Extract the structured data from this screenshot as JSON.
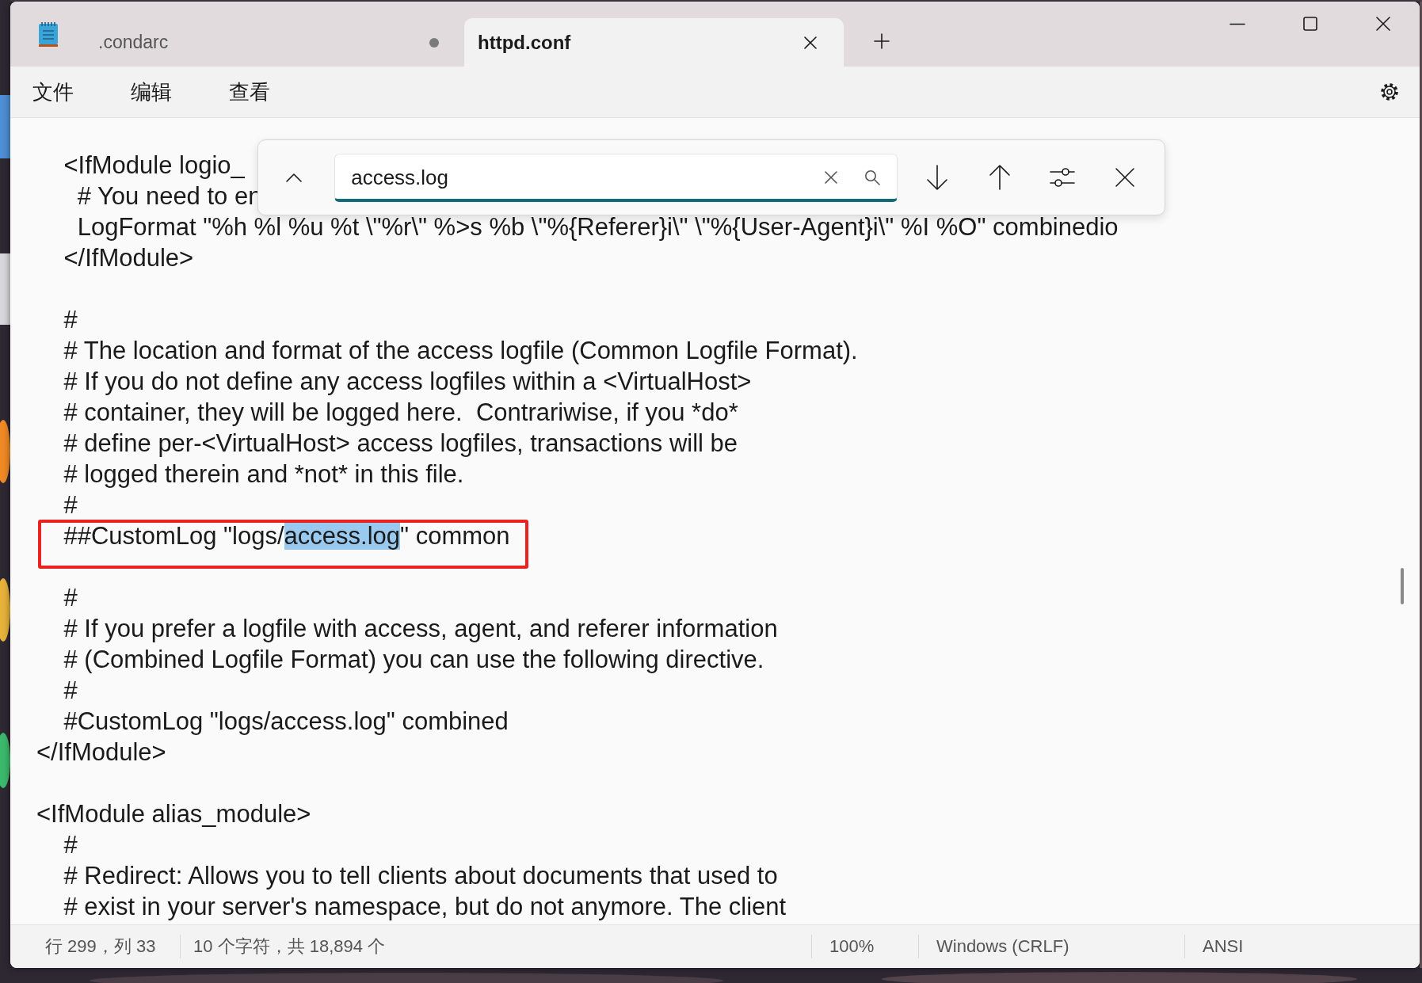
{
  "tabs": [
    {
      "label": ".condarc",
      "selected": false,
      "modified": true
    },
    {
      "label": "httpd.conf",
      "selected": true,
      "modified": false
    }
  ],
  "menu": [
    "文件",
    "编辑",
    "查看"
  ],
  "find_bar": {
    "query": "access.log"
  },
  "editor": {
    "lines": [
      {
        "kind": "plain",
        "text": "    <IfModule logio_"
      },
      {
        "kind": "plain",
        "text": "      # You need to en"
      },
      {
        "kind": "plain",
        "text": "      LogFormat \"%h %l %u %t \\\"%r\\\" %>s %b \\\"%{Referer}i\\\" \\\"%{User-Agent}i\\\" %I %O\" combinedio"
      },
      {
        "kind": "plain",
        "text": "    </IfModule>"
      },
      {
        "kind": "blank"
      },
      {
        "kind": "plain",
        "text": "    #"
      },
      {
        "kind": "plain",
        "text": "    # The location and format of the access logfile (Common Logfile Format)."
      },
      {
        "kind": "plain",
        "text": "    # If you do not define any access logfiles within a <VirtualHost>"
      },
      {
        "kind": "plain",
        "text": "    # container, they will be logged here.  Contrariwise, if you *do*"
      },
      {
        "kind": "plain",
        "text": "    # define per-<VirtualHost> access logfiles, transactions will be"
      },
      {
        "kind": "plain",
        "text": "    # logged therein and *not* in this file."
      },
      {
        "kind": "plain",
        "text": "    #"
      },
      {
        "kind": "match",
        "before": "    ##CustomLog \"logs/",
        "match": "access.log",
        "after": "\" common",
        "boxed": true
      },
      {
        "kind": "blank"
      },
      {
        "kind": "plain",
        "text": "    #"
      },
      {
        "kind": "plain",
        "text": "    # If you prefer a logfile with access, agent, and referer information"
      },
      {
        "kind": "plain",
        "text": "    # (Combined Logfile Format) you can use the following directive."
      },
      {
        "kind": "plain",
        "text": "    #"
      },
      {
        "kind": "plain",
        "text": "    #CustomLog \"logs/access.log\" combined"
      },
      {
        "kind": "plain",
        "text": "</IfModule>"
      },
      {
        "kind": "blank"
      },
      {
        "kind": "plain",
        "text": "<IfModule alias_module>"
      },
      {
        "kind": "plain",
        "text": "    #"
      },
      {
        "kind": "plain",
        "text": "    # Redirect: Allows you to tell clients about documents that used to"
      },
      {
        "kind": "plain",
        "text": "    # exist in your server's namespace, but do not anymore. The client"
      }
    ]
  },
  "status_bar": [
    "行 299，列 33",
    "10 个字符，共 18,894 个",
    "100%",
    "Windows (CRLF)",
    "ANSI"
  ]
}
